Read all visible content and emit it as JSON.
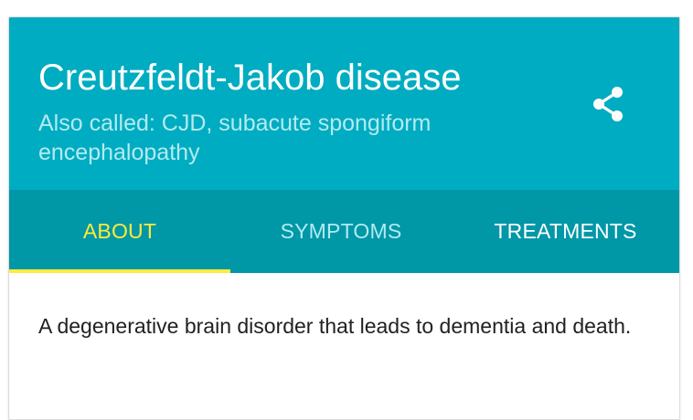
{
  "header": {
    "title": "Creutzfeldt-Jakob disease",
    "also_called": "Also called: CJD, subacute spongiform encephalopathy",
    "share_icon": "share-icon"
  },
  "tabs": [
    {
      "label": "ABOUT",
      "selected": true
    },
    {
      "label": "SYMPTOMS",
      "selected": false
    },
    {
      "label": "TREATMENTS",
      "selected": false
    }
  ],
  "content": {
    "description": "A degenerative brain disorder that leads to dementia and death."
  },
  "colors": {
    "header_bg": "#00acc1",
    "tabbar_bg": "#0097a7",
    "active_tab": "#ffeb3b",
    "subtitle": "#b2ebf2"
  }
}
